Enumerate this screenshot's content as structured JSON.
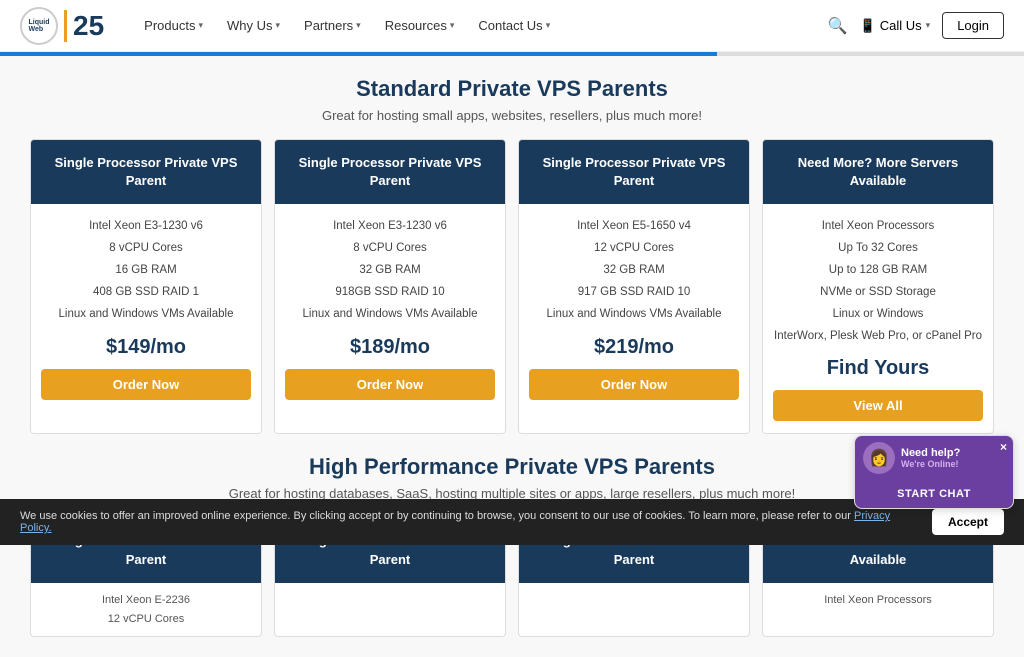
{
  "nav": {
    "logo_text": "LiquidWeb",
    "logo_25": "25",
    "links": [
      {
        "label": "Products",
        "has_chevron": true
      },
      {
        "label": "Why Us",
        "has_chevron": true
      },
      {
        "label": "Partners",
        "has_chevron": true
      },
      {
        "label": "Resources",
        "has_chevron": true
      },
      {
        "label": "Contact Us",
        "has_chevron": true
      }
    ],
    "call_label": "Call Us",
    "login_label": "Login"
  },
  "progress": {
    "fill_pct": "70%"
  },
  "standard_section": {
    "title": "Standard Private VPS Parents",
    "subtitle": "Great for hosting small apps, websites, resellers, plus much more!",
    "cards": [
      {
        "header": "Single Processor Private VPS Parent",
        "specs": [
          "Intel Xeon E3-1230 v6",
          "8 vCPU Cores",
          "16 GB RAM",
          "408 GB SSD RAID 1",
          "Linux and Windows VMs Available"
        ],
        "price": "$149/mo",
        "btn_label": "Order Now"
      },
      {
        "header": "Single Processor Private VPS Parent",
        "specs": [
          "Intel Xeon E3-1230 v6",
          "8 vCPU Cores",
          "32 GB RAM",
          "918GB SSD RAID 10",
          "Linux and Windows VMs Available"
        ],
        "price": "$189/mo",
        "btn_label": "Order Now"
      },
      {
        "header": "Single Processor Private VPS Parent",
        "specs": [
          "Intel Xeon E5-1650 v4",
          "12 vCPU Cores",
          "32 GB RAM",
          "917 GB SSD RAID 10",
          "Linux and Windows VMs Available"
        ],
        "price": "$219/mo",
        "btn_label": "Order Now"
      },
      {
        "header": "Need More? More Servers Available",
        "specs": [
          "Intel Xeon Processors",
          "Up To 32 Cores",
          "Up to 128 GB RAM",
          "NVMe or SSD Storage",
          "Linux or Windows",
          "InterWorx, Plesk Web Pro, or cPanel Pro"
        ],
        "price": "Find Yours",
        "btn_label": "View All",
        "is_find": true
      }
    ]
  },
  "high_perf_section": {
    "title": "High Performance Private VPS Parents",
    "subtitle": "Great for hosting databases, SaaS, hosting multiple sites or apps, large resellers, plus much more!",
    "cards": [
      {
        "header": "Single Processor Private VPS Parent",
        "specs": [
          "Intel Xeon E-2236",
          "12 vCPU Cores"
        ]
      },
      {
        "header": "Single Processor Private VPS Parent",
        "specs": []
      },
      {
        "header": "Single Processor Private VPS Parent",
        "specs": []
      },
      {
        "header": "Need More? More Servers Available",
        "specs": [
          "Intel Xeon Processors"
        ]
      }
    ]
  },
  "cookie": {
    "text": "We use cookies to offer an improved online experience. By clicking accept or by continuing to browse, you consent to our use of cookies. To learn more, please refer to our",
    "link_text": "Privacy Policy.",
    "btn_label": "Accept"
  },
  "chat": {
    "title": "Need help?",
    "status": "We're Online!",
    "btn_label": "START CHAT",
    "close": "×"
  }
}
